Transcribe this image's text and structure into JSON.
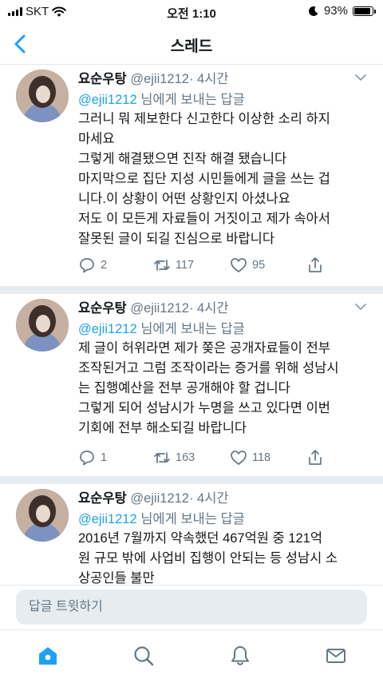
{
  "status_bar": {
    "carrier": "SKT",
    "time": "오전 1:10",
    "battery": "93%",
    "battery_level": 0.93
  },
  "nav": {
    "title": "스레드",
    "back_icon": "chevron-left-icon"
  },
  "colors": {
    "accent": "#1da1f2",
    "text": "#14171a",
    "muted": "#657786",
    "separator": "#e6ecf0"
  },
  "tweets": [
    {
      "author_name": "요순우탕",
      "author_handle": "@ejii1212",
      "time": "· 4시간",
      "reply_handle": "@ejii1212",
      "reply_suffix": " 님에게 보내는 답글",
      "text": "그러니 뭐 제보한다 신고한다 이상한 소리 하지\n마세요\n그렇게 해결됐으면 진작 해결 됐습니다\n마지막으로 집단 지성 시민들에게 글을 쓰는 겁\n니다.이 상황이 어떤 상황인지 아셨나요\n저도 이 모든게 자료들이 거짓이고 제가 속아서\n잘못된 글이 되길 진심으로 바랍니다",
      "replies": "2",
      "retweets": "117",
      "likes": "95"
    },
    {
      "author_name": "요순우탕",
      "author_handle": "@ejii1212",
      "time": "· 4시간",
      "reply_handle": "@ejii1212",
      "reply_suffix": " 님에게 보내는 답글",
      "text": "제 글이 허위라면 제가 쫒은 공개자료들이 전부\n조작된거고 그럼 조작이라는 증거를 위해 성남시\n는 집행예산을 전부 공개해야 할 겁니다\n그렇게 되어 성남시가 누명을 쓰고 있다면 이번\n기회에 전부 해소되길 바랍니다",
      "replies": "1",
      "retweets": "163",
      "likes": "118"
    },
    {
      "author_name": "요순우탕",
      "author_handle": "@ejii1212",
      "time": "· 4시간",
      "reply_handle": "@ejii1212",
      "reply_suffix": " 님에게 보내는 답글",
      "text": "2016년 7월까지 약속했던 467억원 중 121억\n원 규모 밖에 사업비 집행이 안되는 등 성남시 소\n상공인들 불만"
    }
  ],
  "reply_box": {
    "placeholder": "답글 트윗하기"
  },
  "tabs": [
    {
      "name": "home",
      "icon": "home-icon",
      "active": true
    },
    {
      "name": "search",
      "icon": "search-icon",
      "active": false
    },
    {
      "name": "notifications",
      "icon": "bell-icon",
      "active": false
    },
    {
      "name": "messages",
      "icon": "mail-icon",
      "active": false
    }
  ]
}
